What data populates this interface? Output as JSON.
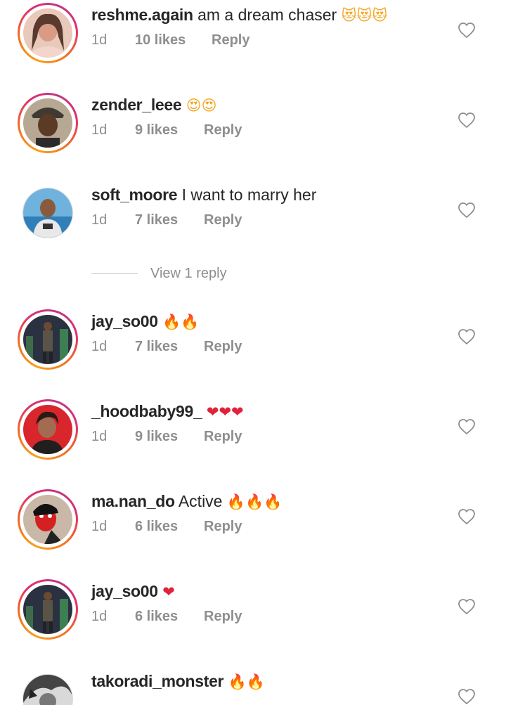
{
  "comments": [
    {
      "username": "reshme.again",
      "text": "am a dream chaser",
      "emoji": "😻😻😻",
      "time": "1d",
      "likes": "10 likes",
      "reply": "Reply",
      "avatar_icon": "avatar-photo",
      "story_ring": true
    },
    {
      "username": "zender_leee",
      "text": "",
      "emoji": "😍😍",
      "time": "1d",
      "likes": "9 likes",
      "reply": "Reply",
      "avatar_icon": "avatar-photo",
      "story_ring": true
    },
    {
      "username": "soft_moore",
      "text": "I want to marry her",
      "emoji": "",
      "time": "1d",
      "likes": "7 likes",
      "reply": "Reply",
      "avatar_icon": "avatar-photo",
      "story_ring": false
    },
    {
      "username": "jay_so00",
      "text": "",
      "emoji": "🔥🔥",
      "time": "1d",
      "likes": "7 likes",
      "reply": "Reply",
      "avatar_icon": "avatar-photo",
      "story_ring": true
    },
    {
      "username": "_hoodbaby99_",
      "text": "",
      "emoji": "❤❤❤",
      "time": "1d",
      "likes": "9 likes",
      "reply": "Reply",
      "avatar_icon": "avatar-photo",
      "story_ring": true
    },
    {
      "username": "ma.nan_do",
      "text": "Active",
      "emoji": "🔥🔥🔥",
      "time": "1d",
      "likes": "6 likes",
      "reply": "Reply",
      "avatar_icon": "avatar-photo",
      "story_ring": true
    },
    {
      "username": "jay_so00",
      "text": "",
      "emoji": "❤",
      "time": "1d",
      "likes": "6 likes",
      "reply": "Reply",
      "avatar_icon": "avatar-photo",
      "story_ring": true
    },
    {
      "username": "takoradi_monster",
      "text": "",
      "emoji": "🔥🔥",
      "time": "",
      "likes": "",
      "reply": "",
      "avatar_icon": "avatar-photo",
      "story_ring": false
    }
  ],
  "view_replies": {
    "label": "View 1 reply"
  },
  "icons": {
    "like": "heart-outline-icon"
  },
  "colors": {
    "username": "#262626",
    "meta": "#8e8e8e",
    "ring_start": "#f9a11b",
    "ring_end": "#c13584"
  }
}
